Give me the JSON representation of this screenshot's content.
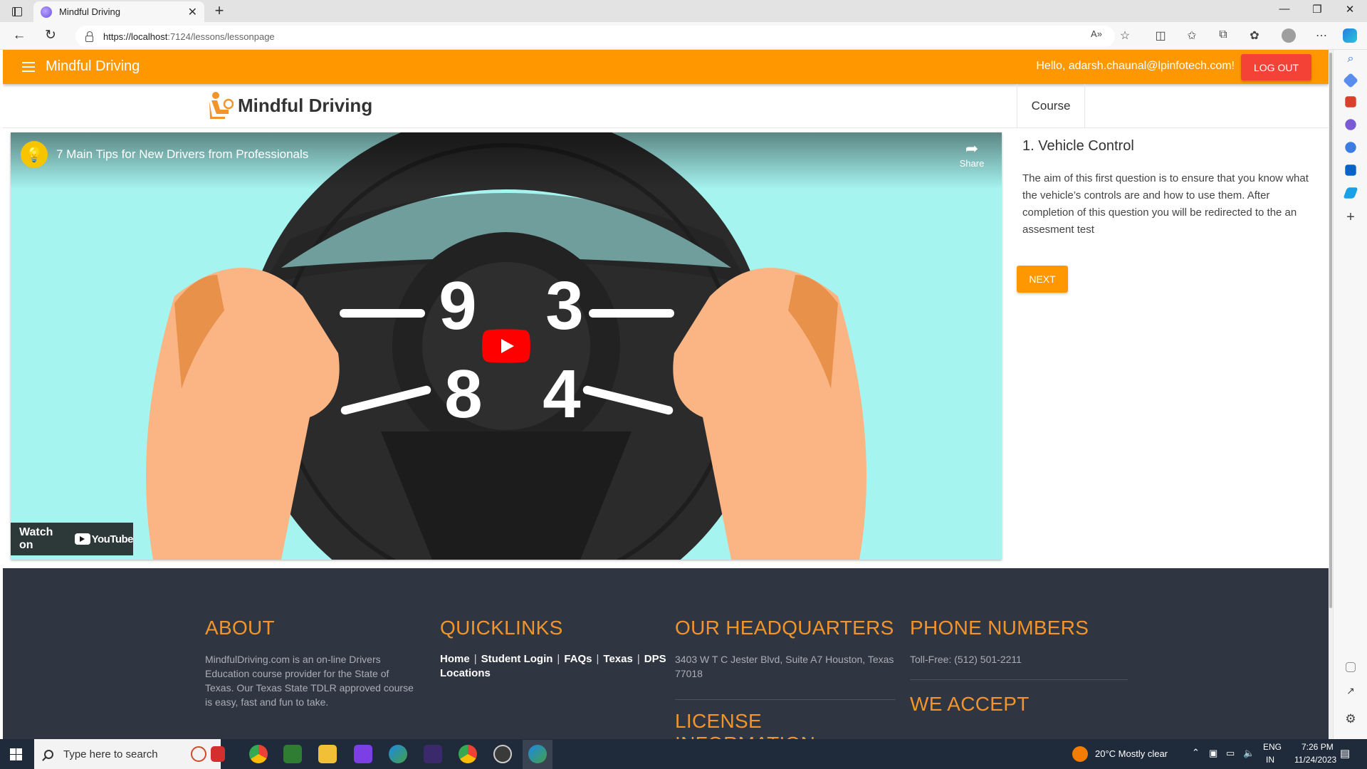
{
  "browser": {
    "tab_title": "Mindful Driving",
    "tab_close": "✕",
    "new_tab": "+",
    "url_host": "https://localhost",
    "url_path": ":7124/lessons/lessonpage"
  },
  "appbar": {
    "title": "Mindful Driving",
    "greeting": "Hello, adarsh.chaunal@lpinfotech.com!",
    "logout_label": "LOG OUT"
  },
  "header": {
    "logo_text": "Mindful Driving",
    "nav_course": "Course"
  },
  "video": {
    "title": "7 Main Tips for New Drivers from Professionals",
    "share_label": "Share",
    "watch_on": "Watch on",
    "youtube": "YouTube",
    "wheel_numbers": [
      "9",
      "3",
      "8",
      "4"
    ]
  },
  "lesson": {
    "title": "1. Vehicle Control",
    "description": "The aim of this first question is to ensure that you know what the vehicle’s controls are and how to use them. After completion of this question you will be redirected to the an assesment test",
    "next_label": "NEXT"
  },
  "footer": {
    "about_heading": "ABOUT",
    "about_text": "MindfulDriving.com is an on-line Drivers Education course provider for the State of Texas. Our Texas State TDLR approved course is easy, fast and fun to take.",
    "quicklinks_heading": "QUICKLINKS",
    "quicklinks": [
      "Home",
      "Student Login",
      "FAQs",
      "Texas",
      "DPS",
      "Locations"
    ],
    "hq_heading": "OUR HEADQUARTERS",
    "hq_address": "3403 W T C Jester Blvd, Suite A7 Houston, Texas 77018",
    "license_heading": "LICENSE INFORMATION",
    "phone_heading": "PHONE NUMBERS",
    "phone_text": "Toll-Free: (512) 501-2211",
    "accept_heading": "WE ACCEPT"
  },
  "taskbar": {
    "search_placeholder": "Type here to search",
    "weather": "20°C  Mostly clear",
    "lang_1": "ENG",
    "lang_2": "IN",
    "time": "7:26 PM",
    "date": "11/24/2023"
  },
  "colors": {
    "accent": "#ff9800",
    "logout": "#f44336",
    "footer_bg": "#303641",
    "footer_heading": "#f2942c",
    "video_bg": "#a6f4f0"
  }
}
